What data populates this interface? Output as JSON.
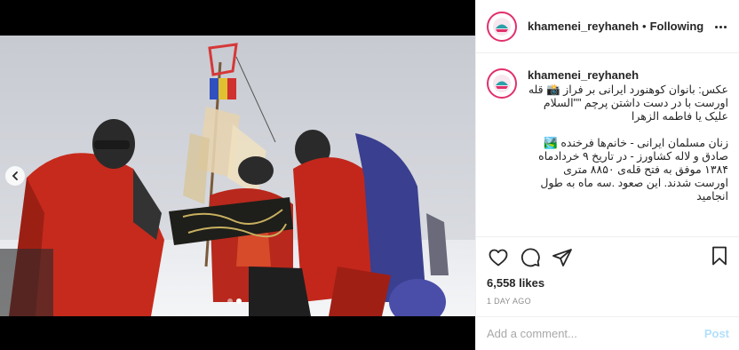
{
  "post": {
    "username": "khamenei_reyhaneh",
    "separator": "•",
    "follow_status": "Following",
    "caption_user": "khamenei_reyhaneh",
    "caption_paragraphs": [
      "عکس: بانوان کوهنورد ایرانی بر فراز 📸 قله اورست با در دست داشتن پرچم \"\"السلام علیک یا فاطمه الزهرا",
      "زنان مسلمان ایرانی - خانم‌ها فرخنده 🏞️ صادق و لاله کشاورز - در تاریخ ۹ خردادماه ۱۳۸۴ موفق به فتح قله‌ی ۸۸۵۰ متری اورست شدند. این صعود .سه ماه به طول انجامید"
    ],
    "views": "6,558 likes",
    "timestamp": "1 DAY AGO"
  },
  "comment_box": {
    "placeholder": "Add a comment...",
    "post_label": "Post"
  },
  "icons": {
    "like": "heart-icon",
    "comment": "comment-icon",
    "share": "share-icon",
    "save": "bookmark-icon",
    "more": "more-icon",
    "prev": "chevron-left-icon"
  },
  "colors": {
    "accent_ring": "#e1306c",
    "post_button": "#b2dffc",
    "muted": "#8e8e8e"
  },
  "carousel": {
    "slide_count": 2,
    "active_index": 1
  }
}
